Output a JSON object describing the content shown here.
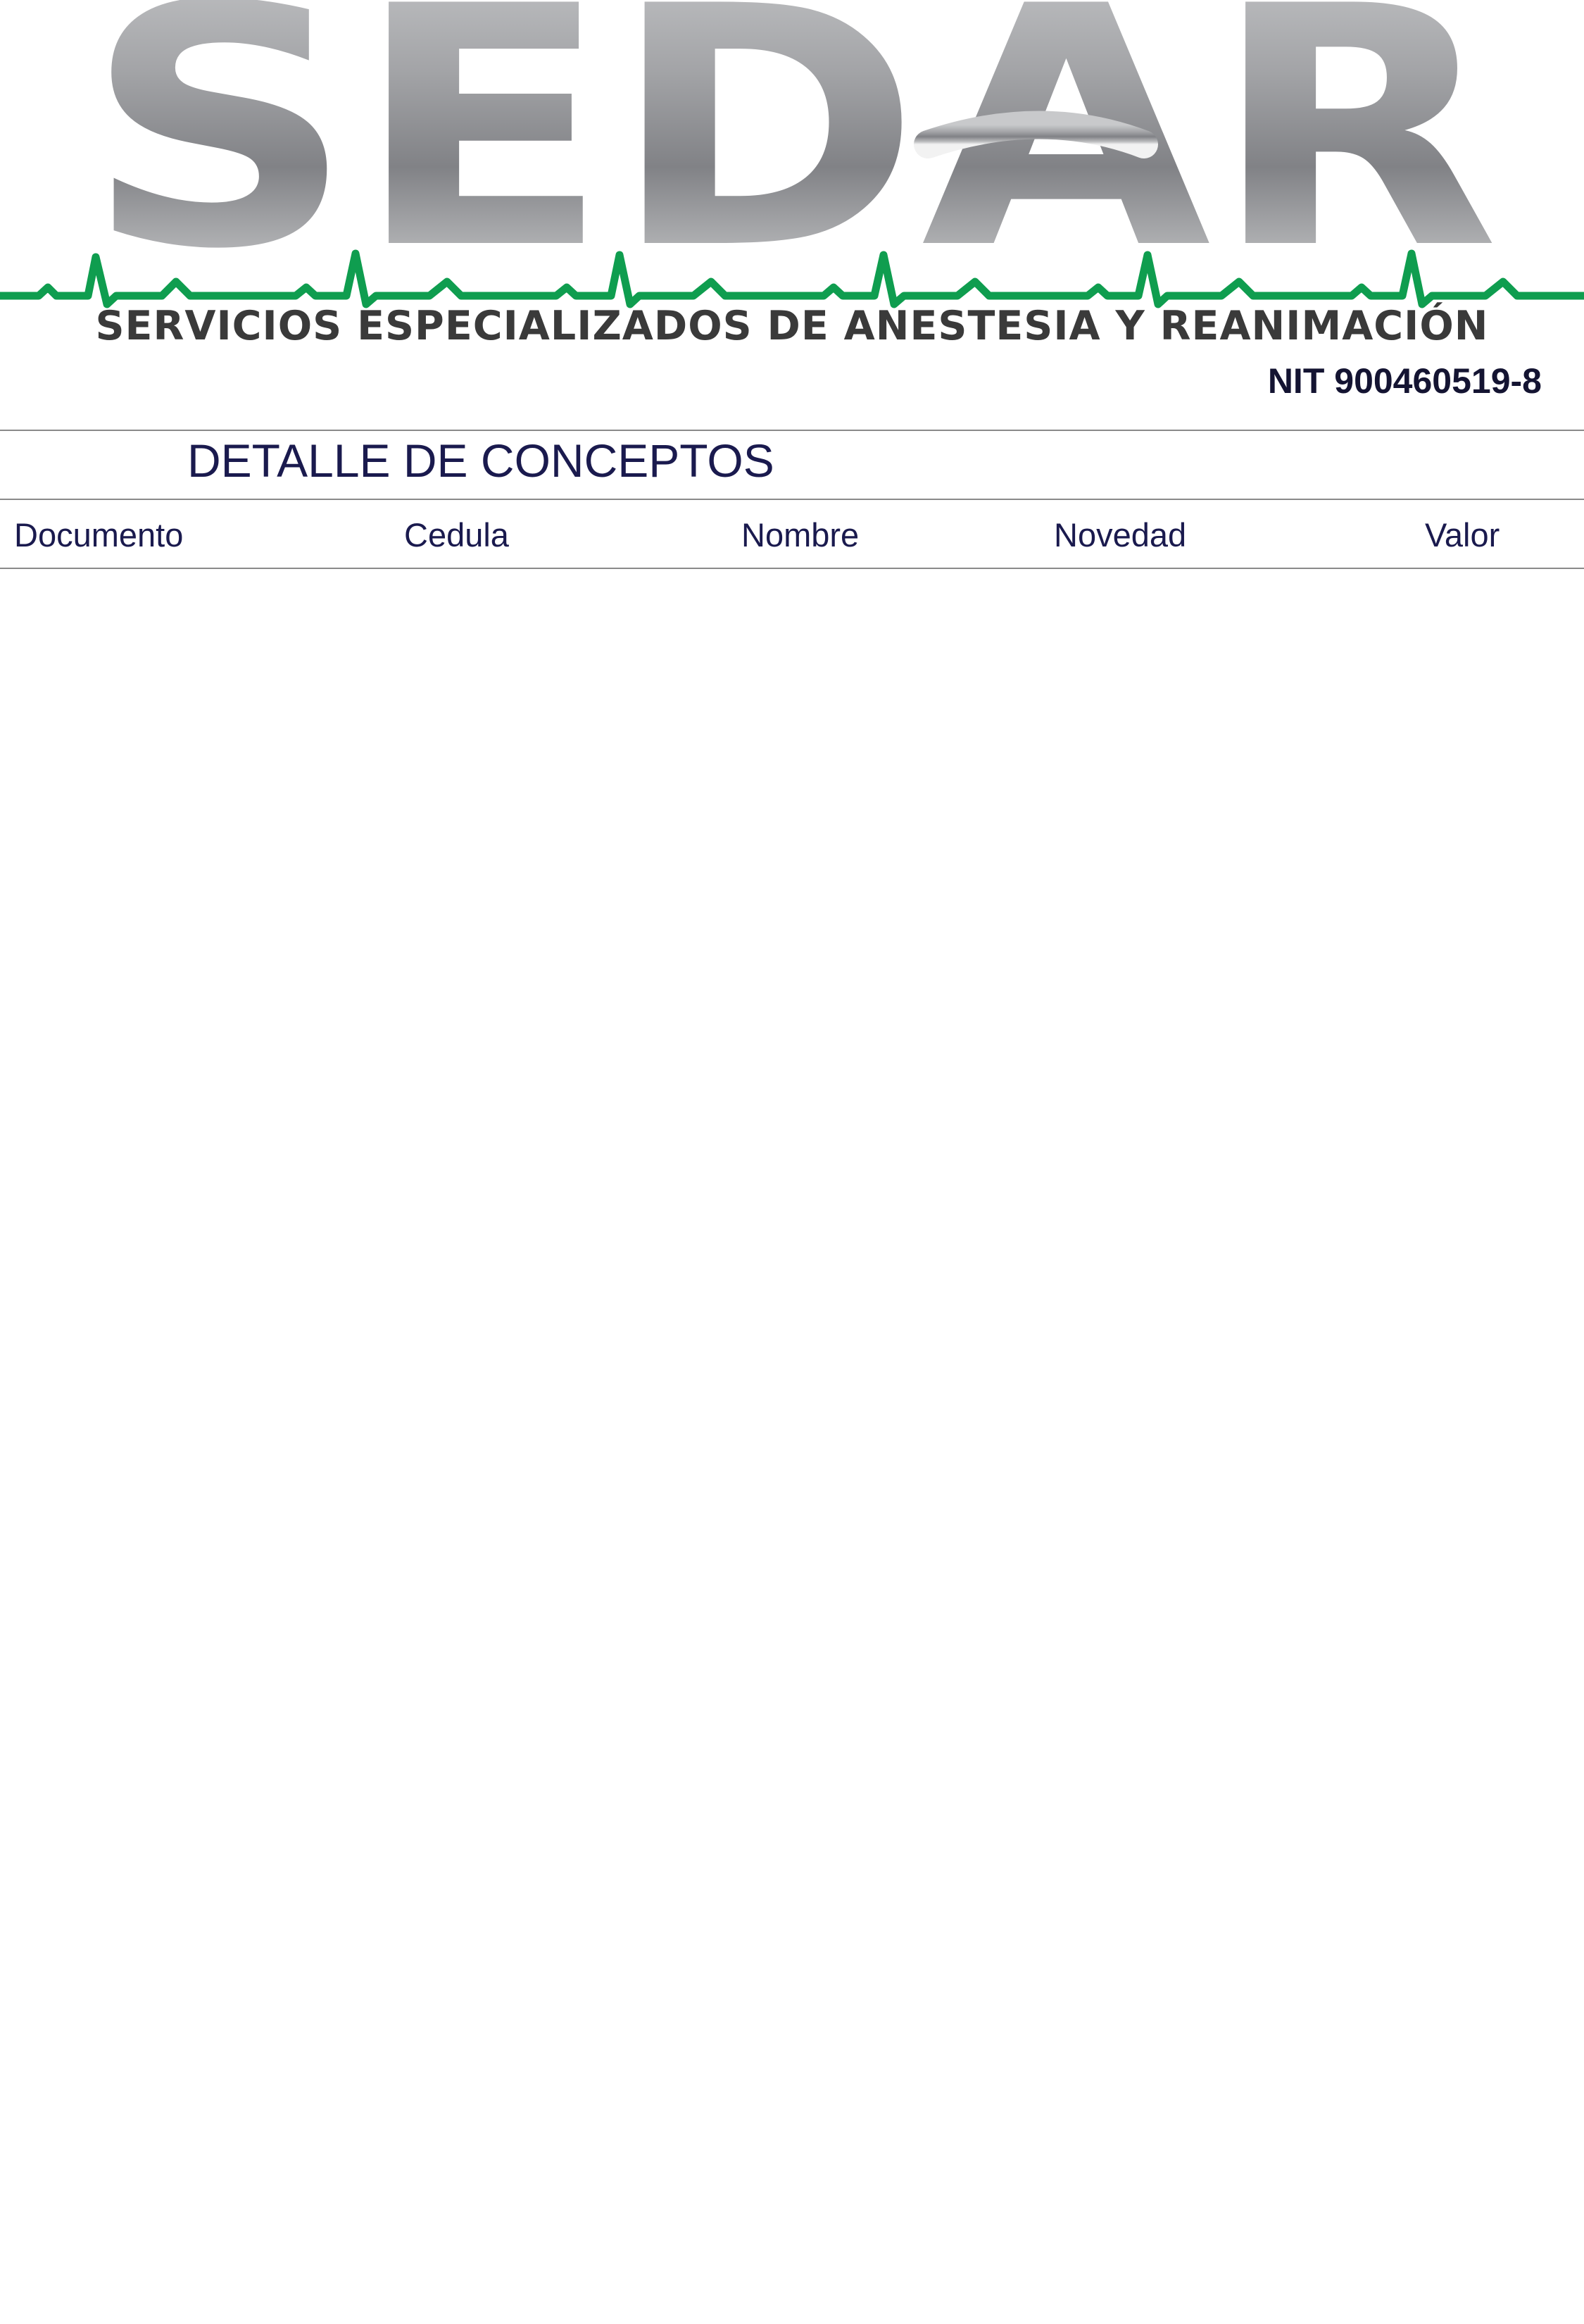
{
  "letterhead": {
    "logo_text": "SEDAR",
    "tagline": "SERVICIOS ESPECIALIZADOS DE ANESTESIA Y REANIMACIÓN",
    "nit": "NIT 900460519-8",
    "colors": {
      "logo_gray": "#8c8d90",
      "heartbeat_green": "#0f9d4f",
      "tagline": "#3a3a3a"
    }
  },
  "report": {
    "title": "DETALLE DE CONCEPTOS",
    "columns": [
      "Documento",
      "Cedula",
      "Nombre",
      "Novedad",
      "Valor"
    ],
    "rows": []
  }
}
